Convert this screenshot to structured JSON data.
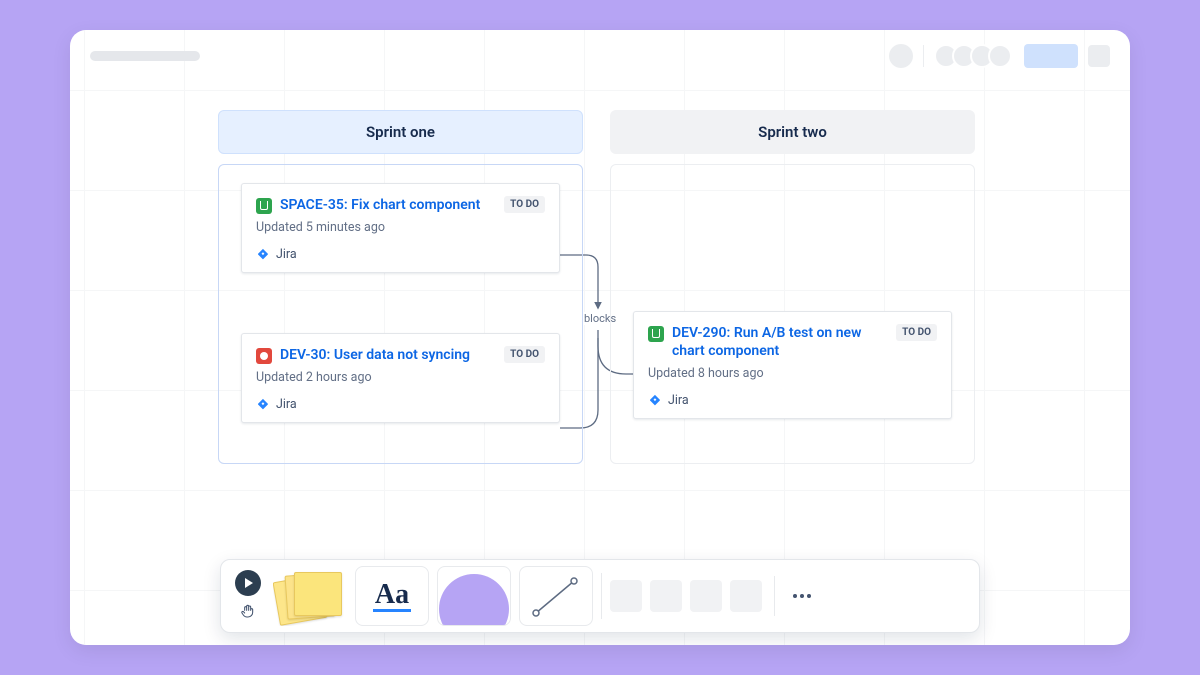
{
  "columns": {
    "one": {
      "title": "Sprint one"
    },
    "two": {
      "title": "Sprint two"
    }
  },
  "connector": {
    "label": "blocks"
  },
  "cards": {
    "c1": {
      "title": "SPACE-35: Fix chart component",
      "status": "TO DO",
      "updated": "Updated 5 minutes ago",
      "source": "Jira"
    },
    "c2": {
      "title": "DEV-30: User data not syncing",
      "status": "TO DO",
      "updated": "Updated 2 hours ago",
      "source": "Jira"
    },
    "c3": {
      "title": "DEV-290: Run A/B test on new chart component",
      "status": "TO DO",
      "updated": "Updated 8 hours ago",
      "source": "Jira"
    }
  },
  "toolbar": {
    "text_tool_label": "Aa"
  }
}
